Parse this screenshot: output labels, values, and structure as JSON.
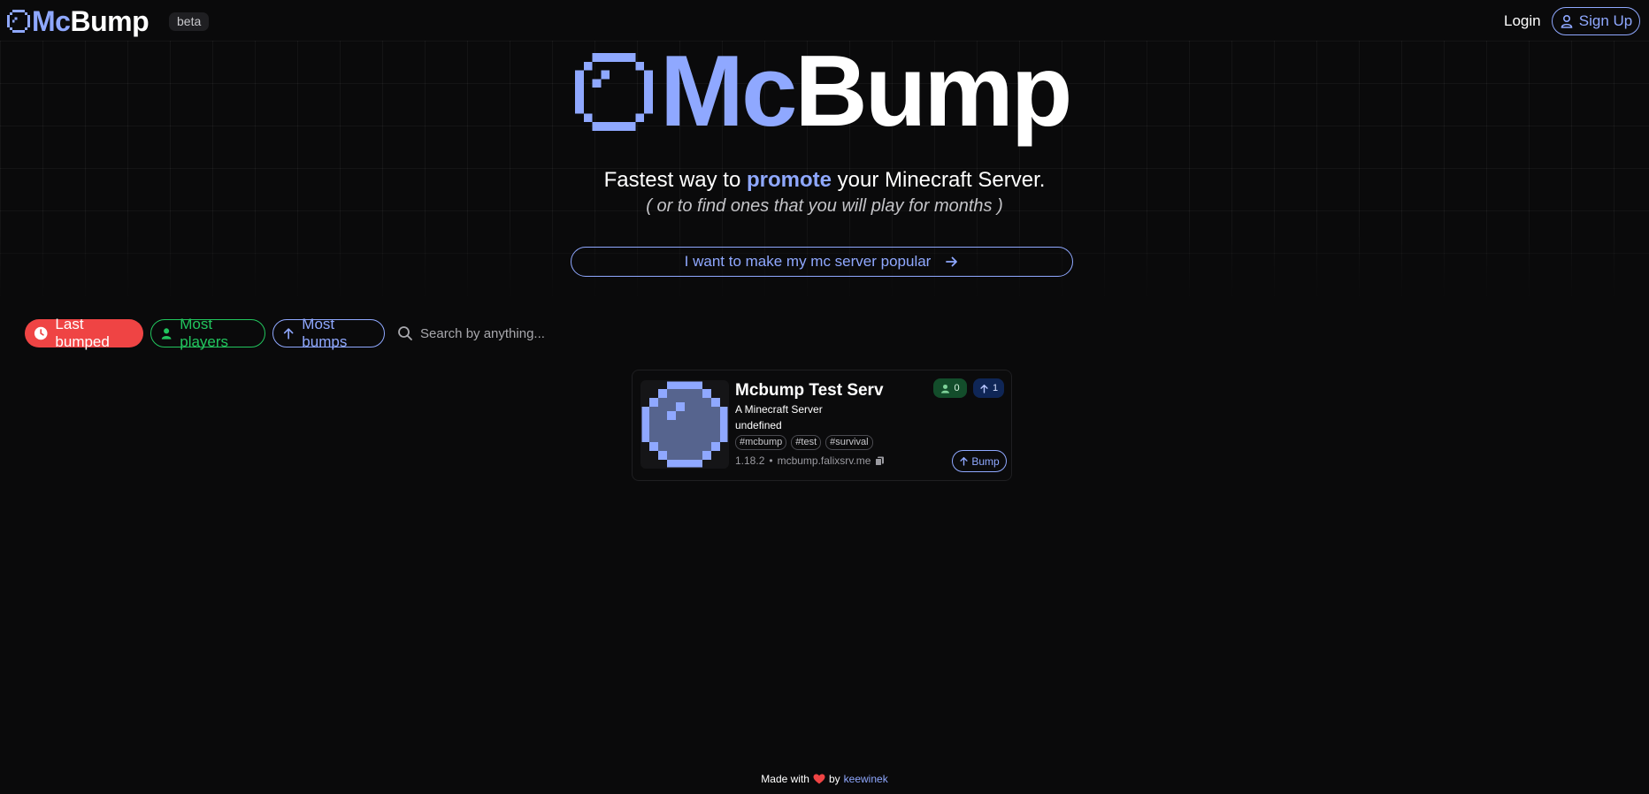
{
  "header": {
    "brand_mc": "Mc",
    "brand_bump": "Bump",
    "badge": "beta",
    "login_label": "Login",
    "signup_label": "Sign Up"
  },
  "hero": {
    "title_mc": "Mc",
    "title_bump": "Bump",
    "tagline_prefix": "Fastest way to ",
    "tagline_highlight": "promote",
    "tagline_suffix": " your Minecraft Server.",
    "subtagline": "( or to find ones that you will play for months )",
    "cta_label": "I want to make my mc server popular"
  },
  "filters": {
    "last_bumped": "Last bumped",
    "most_players": "Most players",
    "most_bumps": "Most bumps",
    "search_placeholder": "Search by anything..."
  },
  "servers": [
    {
      "name": "Mcbump Test Serv",
      "description": "A Minecraft Server",
      "extra": "undefined",
      "tags": [
        "#mcbump",
        "#test",
        "#survival"
      ],
      "version": "1.18.2",
      "separator": "•",
      "address": "mcbump.falixsrv.me",
      "players": "0",
      "bumps": "1",
      "bump_label": "Bump"
    }
  ],
  "footer": {
    "made_with": "Made with",
    "by": "by",
    "author": "keewinek"
  },
  "colors": {
    "accent": "#8fa8ff",
    "red": "#ef4444",
    "green": "#22c55e",
    "background": "#0a0a0b"
  },
  "icons": [
    "logo-icon",
    "user-icon",
    "arrow-right-icon",
    "clock-icon",
    "arrow-up-icon",
    "search-icon",
    "copy-icon",
    "heart-icon"
  ]
}
